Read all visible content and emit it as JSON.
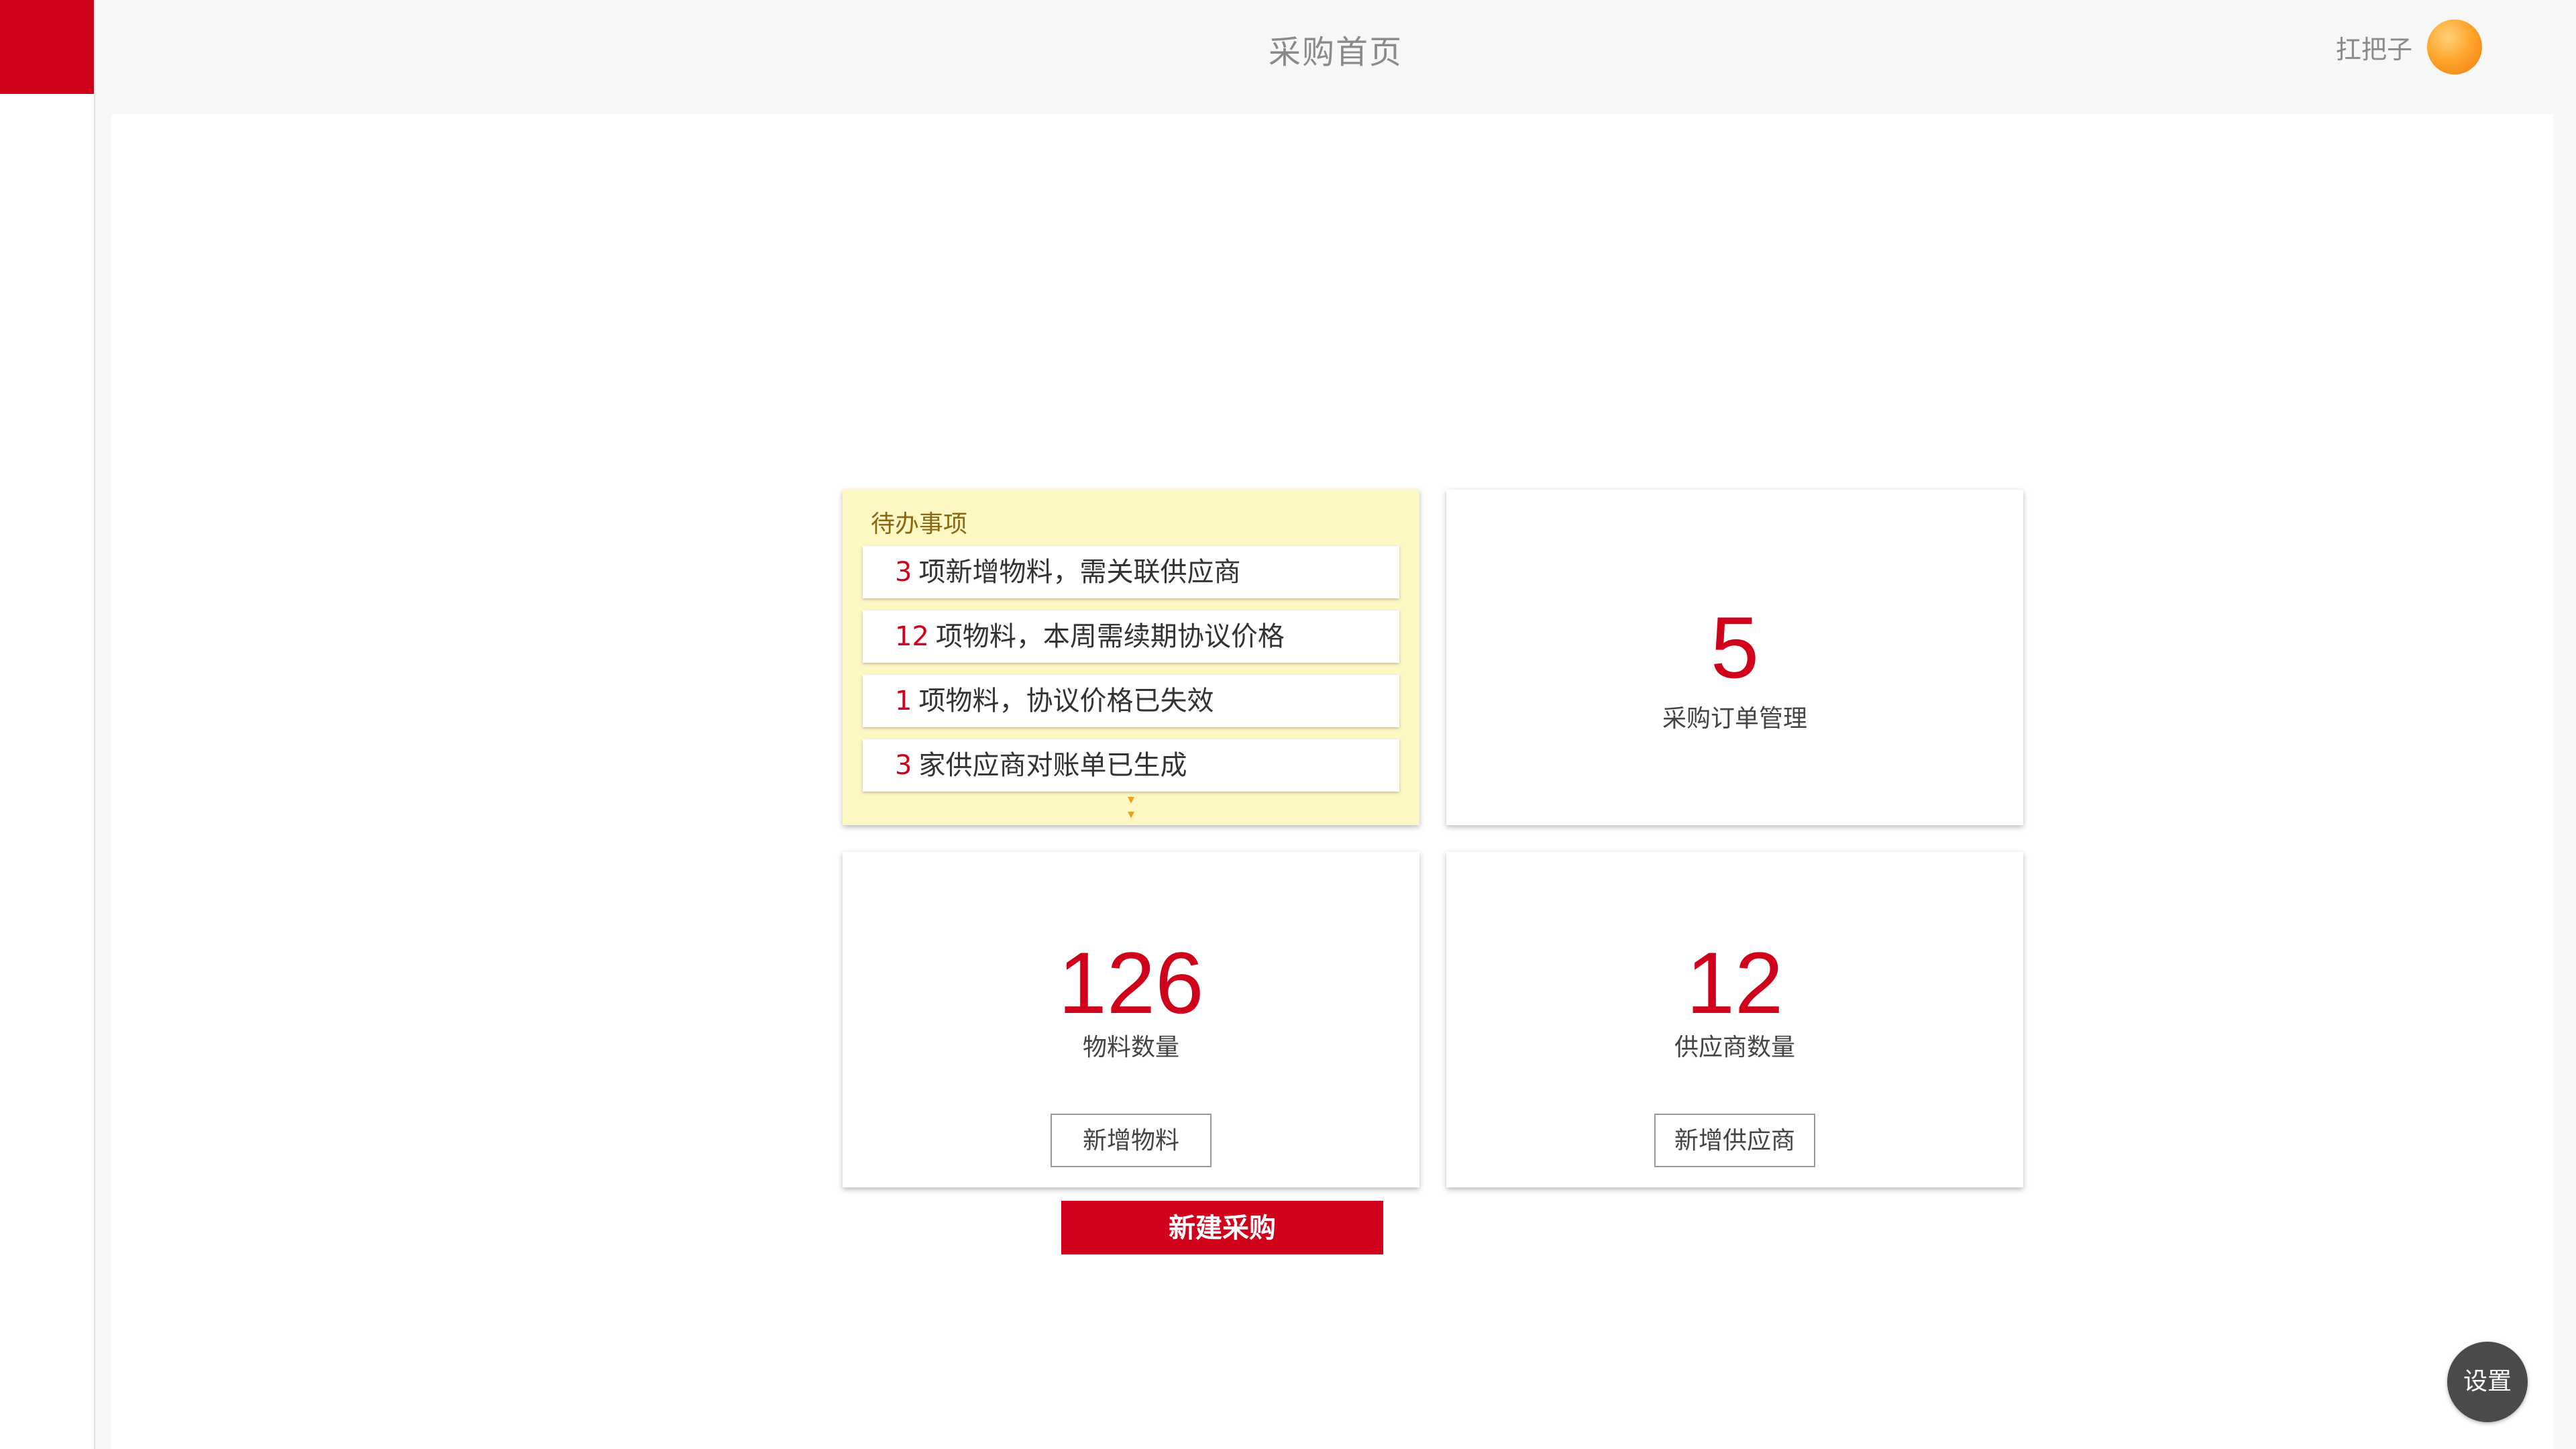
{
  "header": {
    "title": "采购首页",
    "username": "扛把子"
  },
  "todo": {
    "title": "待办事项",
    "items": [
      {
        "count": "3",
        "text": "项新增物料，需关联供应商"
      },
      {
        "count": "12",
        "text": "项物料，本周需续期协议价格"
      },
      {
        "count": "1",
        "text": "项物料，协议价格已失效"
      },
      {
        "count": "3",
        "text": "家供应商对账单已生成"
      }
    ],
    "expand_icon": "double-chevron-down-icon"
  },
  "orders": {
    "count": "5",
    "label": "采购订单管理"
  },
  "materials": {
    "count": "126",
    "label": "物料数量",
    "button_label": "新增物料"
  },
  "suppliers": {
    "count": "12",
    "label": "供应商数量",
    "button_label": "新增供应商"
  },
  "actions": {
    "new_purchase_label": "新建采购",
    "settings_label": "设置"
  },
  "colors": {
    "brand_red": "#d0021b",
    "todo_background": "#fdf7c3",
    "avatar_orange": "#ffa62e"
  }
}
